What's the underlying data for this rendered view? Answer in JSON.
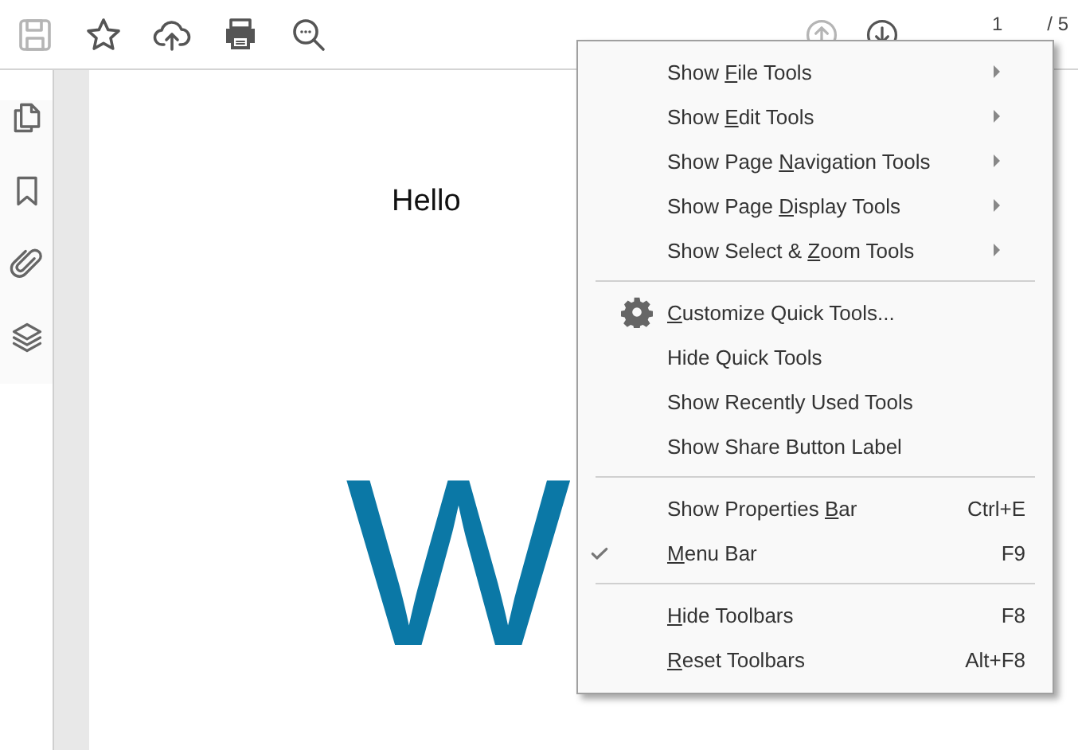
{
  "toolbar": {
    "tools": [
      {
        "kind": "save",
        "disabled": true
      },
      {
        "kind": "star",
        "disabled": false
      },
      {
        "kind": "upload",
        "disabled": false
      },
      {
        "kind": "print",
        "disabled": false
      },
      {
        "kind": "zoom",
        "disabled": false
      }
    ],
    "page_nav": [
      {
        "kind": "previous",
        "disabled": true
      },
      {
        "kind": "next",
        "disabled": false
      }
    ],
    "page_number": "1",
    "page_count": "/ 5"
  },
  "sidebar": {
    "tools": [
      {
        "kind": "pages"
      },
      {
        "kind": "bookmark"
      },
      {
        "kind": "attachment"
      },
      {
        "kind": "layers"
      }
    ]
  },
  "document": {
    "heading": "Hello",
    "large_text": [
      "W"
    ]
  },
  "context_menu": {
    "groups": [
      {
        "items": [
          {
            "kind": "submenu",
            "checked": false,
            "label": [
              {
                "text": "Show ",
                "access_key": false
              },
              {
                "text": "F",
                "access_key": true
              },
              {
                "text": "ile Tools",
                "access_key": false
              }
            ]
          },
          {
            "kind": "submenu",
            "checked": false,
            "label": [
              {
                "text": "Show ",
                "access_key": false
              },
              {
                "text": "E",
                "access_key": true
              },
              {
                "text": "dit Tools",
                "access_key": false
              }
            ]
          },
          {
            "kind": "submenu",
            "checked": false,
            "label": [
              {
                "text": "Show Page ",
                "access_key": false
              },
              {
                "text": "N",
                "access_key": true
              },
              {
                "text": "avigation Tools",
                "access_key": false
              }
            ]
          },
          {
            "kind": "submenu",
            "checked": false,
            "label": [
              {
                "text": "Show Page ",
                "access_key": false
              },
              {
                "text": "D",
                "access_key": true
              },
              {
                "text": "isplay Tools",
                "access_key": false
              }
            ]
          },
          {
            "kind": "submenu",
            "checked": false,
            "label": [
              {
                "text": "Show Select & ",
                "access_key": false
              },
              {
                "text": "Z",
                "access_key": true
              },
              {
                "text": "oom Tools",
                "access_key": false
              }
            ]
          }
        ]
      },
      {
        "items": [
          {
            "kind": "settings",
            "checked": false,
            "label": [
              {
                "text": "C",
                "access_key": true
              },
              {
                "text": "ustomize Quick Tools...",
                "access_key": false
              }
            ]
          },
          {
            "kind": "command",
            "checked": false,
            "label": [
              {
                "text": "Hide Quick Tools",
                "access_key": false
              }
            ]
          },
          {
            "kind": "command",
            "checked": false,
            "label": [
              {
                "text": "Show Recently Used Tools",
                "access_key": false
              }
            ]
          },
          {
            "kind": "command",
            "checked": false,
            "label": [
              {
                "text": "Show Share Button Label",
                "access_key": false
              }
            ]
          }
        ]
      },
      {
        "items": [
          {
            "kind": "command",
            "checked": false,
            "shortcut": "Ctrl+E",
            "label": [
              {
                "text": "Show Properties ",
                "access_key": false
              },
              {
                "text": "B",
                "access_key": true
              },
              {
                "text": "ar",
                "access_key": false
              }
            ]
          },
          {
            "kind": "command",
            "checked": true,
            "shortcut": "F9",
            "label": [
              {
                "text": "M",
                "access_key": true
              },
              {
                "text": "enu Bar",
                "access_key": false
              }
            ]
          }
        ]
      },
      {
        "items": [
          {
            "kind": "command",
            "checked": false,
            "shortcut": "F8",
            "label": [
              {
                "text": "H",
                "access_key": true
              },
              {
                "text": "ide Toolbars",
                "access_key": false
              }
            ]
          },
          {
            "kind": "command",
            "checked": false,
            "shortcut": "Alt+F8",
            "label": [
              {
                "text": "R",
                "access_key": true
              },
              {
                "text": "eset Toolbars",
                "access_key": false
              }
            ]
          }
        ]
      }
    ]
  }
}
